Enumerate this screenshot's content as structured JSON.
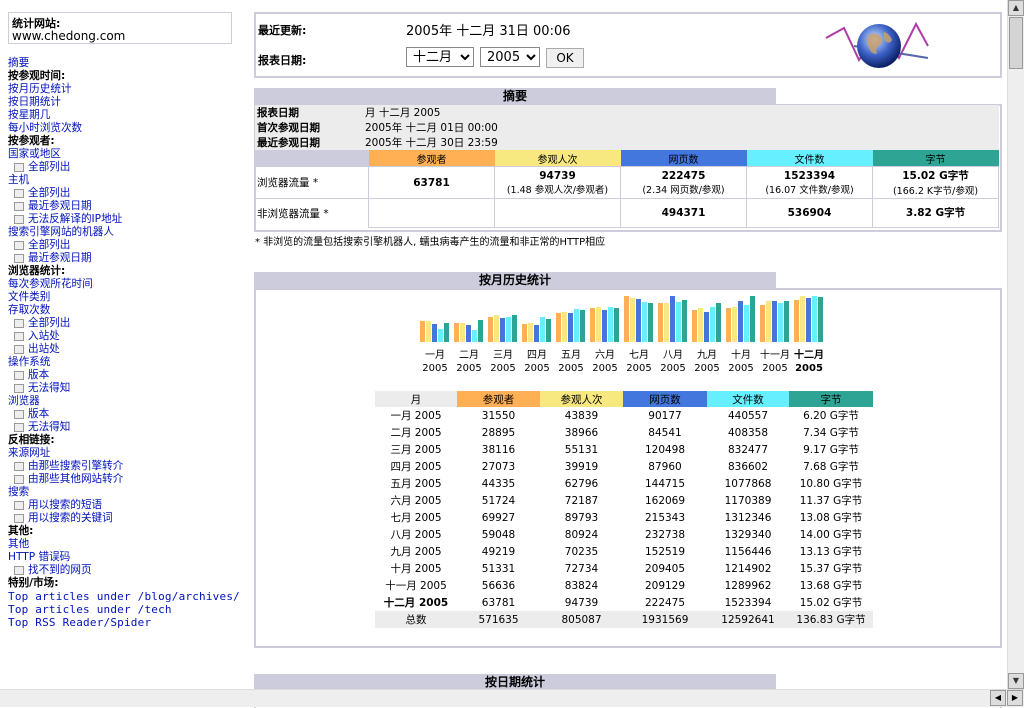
{
  "site": {
    "label": "统计网站:",
    "value": "www.chedong.com"
  },
  "nav": [
    {
      "text": "摘要",
      "type": "link"
    },
    {
      "text": "按参观时间:",
      "type": "head"
    },
    {
      "text": "按月历史统计",
      "type": "link"
    },
    {
      "text": "按日期统计",
      "type": "link"
    },
    {
      "text": "按星期几",
      "type": "link"
    },
    {
      "text": "每小时浏览次数",
      "type": "link"
    },
    {
      "text": "按参观者:",
      "type": "head"
    },
    {
      "text": "国家或地区",
      "type": "link"
    },
    {
      "text": "全部列出",
      "type": "sub"
    },
    {
      "text": "主机",
      "type": "link"
    },
    {
      "text": "全部列出",
      "type": "sub"
    },
    {
      "text": "最近参观日期",
      "type": "sub"
    },
    {
      "text": "无法反解译的IP地址",
      "type": "sub"
    },
    {
      "text": "搜索引擎网站的机器人",
      "type": "link"
    },
    {
      "text": "全部列出",
      "type": "sub"
    },
    {
      "text": "最近参观日期",
      "type": "sub"
    },
    {
      "text": "浏览器统计:",
      "type": "head"
    },
    {
      "text": "每次参观所花时间",
      "type": "link"
    },
    {
      "text": "文件类别",
      "type": "link"
    },
    {
      "text": "存取次数",
      "type": "link"
    },
    {
      "text": "全部列出",
      "type": "sub"
    },
    {
      "text": "入站处",
      "type": "sub"
    },
    {
      "text": "出站处",
      "type": "sub"
    },
    {
      "text": "操作系统",
      "type": "link"
    },
    {
      "text": "版本",
      "type": "sub"
    },
    {
      "text": "无法得知",
      "type": "sub"
    },
    {
      "text": "浏览器",
      "type": "link"
    },
    {
      "text": "版本",
      "type": "sub"
    },
    {
      "text": "无法得知",
      "type": "sub"
    },
    {
      "text": "反相链接:",
      "type": "head"
    },
    {
      "text": "来源网址",
      "type": "link"
    },
    {
      "text": "由那些搜索引擎转介",
      "type": "sub"
    },
    {
      "text": "由那些其他网站转介",
      "type": "sub"
    },
    {
      "text": "搜索",
      "type": "link"
    },
    {
      "text": "用以搜索的短语",
      "type": "sub"
    },
    {
      "text": "用以搜索的关键词",
      "type": "sub"
    },
    {
      "text": "其他:",
      "type": "head"
    },
    {
      "text": "其他",
      "type": "link"
    },
    {
      "text": "HTTP 错误码",
      "type": "link"
    },
    {
      "text": "找不到的网页",
      "type": "sub"
    },
    {
      "text": "特别/市场:",
      "type": "head"
    },
    {
      "text": "Top articles under /blog/archives/",
      "type": "mono"
    },
    {
      "text": "Top articles under /tech",
      "type": "mono"
    },
    {
      "text": "Top RSS Reader/Spider",
      "type": "mono"
    }
  ],
  "top": {
    "last_update_label": "最近更新:",
    "last_update_value": "2005年 十二月 31日 00:06",
    "report_date_label": "报表日期:",
    "month_selected": "十二月",
    "year_selected": "2005",
    "ok_label": "OK"
  },
  "summary": {
    "title": "摘要",
    "period_label": "报表日期",
    "period_value": "月 十二月 2005",
    "first_label": "首次参观日期",
    "first_value": "2005年 十二月 01日 00:00",
    "last_label": "最近参观日期",
    "last_value": "2005年 十二月 30日 23:59",
    "headers": [
      "参观者",
      "参观人次",
      "网页数",
      "文件数",
      "字节"
    ],
    "viewed_label": "浏览器流量 *",
    "viewed": [
      "63781",
      "94739",
      "222475",
      "1523394",
      "15.02 G字节"
    ],
    "viewed_sub": [
      "",
      "(1.48 参观人次/参观者)",
      "(2.34 网页数/参观)",
      "(16.07 文件数/参观)",
      "(166.2 K字节/参观)"
    ],
    "notviewed_label": "非浏览器流量 *",
    "notviewed": [
      "",
      "",
      "494371",
      "536904",
      "3.82 G字节"
    ],
    "footnote": "* 非浏览的流量包括搜索引擎机器人, 蠕虫病毒产生的流量和非正常的HTTP相应"
  },
  "monthly": {
    "title": "按月历史统计",
    "headers": [
      "月",
      "参观者",
      "参观人次",
      "网页数",
      "文件数",
      "字节"
    ],
    "total_label": "总数",
    "total": [
      "571635",
      "805087",
      "1931569",
      "12592641",
      "136.83 G字节"
    ]
  },
  "daily": {
    "title": "按日期统计"
  },
  "colors": {
    "visitors": "#ffb055",
    "visits": "#f8e880",
    "pages": "#4477dd",
    "files": "#66f0ff",
    "bytes": "#2ea495",
    "frame": "#ccccdd",
    "link": "#0011bb"
  },
  "chart_data": {
    "type": "bar",
    "categories": [
      "一月 2005",
      "二月 2005",
      "三月 2005",
      "四月 2005",
      "五月 2005",
      "六月 2005",
      "七月 2005",
      "八月 2005",
      "九月 2005",
      "十月 2005",
      "十一月 2005",
      "十二月 2005"
    ],
    "cat_top": [
      "一月",
      "二月",
      "三月",
      "四月",
      "五月",
      "六月",
      "七月",
      "八月",
      "九月",
      "十月",
      "十一月",
      "十二月"
    ],
    "cat_bottom": [
      "2005",
      "2005",
      "2005",
      "2005",
      "2005",
      "2005",
      "2005",
      "2005",
      "2005",
      "2005",
      "2005",
      "2005"
    ],
    "series": [
      {
        "name": "参观者",
        "values": [
          31550,
          28895,
          38116,
          27073,
          44335,
          51724,
          69927,
          59048,
          49219,
          51331,
          56636,
          63781
        ]
      },
      {
        "name": "参观人次",
        "values": [
          43839,
          38966,
          55131,
          39919,
          62796,
          72187,
          89793,
          80924,
          70235,
          72734,
          83824,
          94739
        ]
      },
      {
        "name": "网页数",
        "values": [
          90177,
          84541,
          120498,
          87960,
          144715,
          162069,
          215343,
          232738,
          152519,
          209405,
          209129,
          222475
        ]
      },
      {
        "name": "文件数",
        "values": [
          440557,
          408358,
          832477,
          836602,
          1077868,
          1170389,
          1312346,
          1329340,
          1156446,
          1214902,
          1289962,
          1523394
        ]
      },
      {
        "name": "字节",
        "values": [
          "6.20 G字节",
          "7.34 G字节",
          "9.17 G字节",
          "7.68 G字节",
          "10.80 G字节",
          "11.37 G字节",
          "13.08 G字节",
          "14.00 G字节",
          "13.13 G字节",
          "15.37 G字节",
          "13.68 G字节",
          "15.02 G字节"
        ]
      }
    ],
    "bytes_numeric": [
      6.2,
      7.34,
      9.17,
      7.68,
      10.8,
      11.37,
      13.08,
      14.0,
      13.13,
      15.37,
      13.68,
      15.02
    ]
  }
}
